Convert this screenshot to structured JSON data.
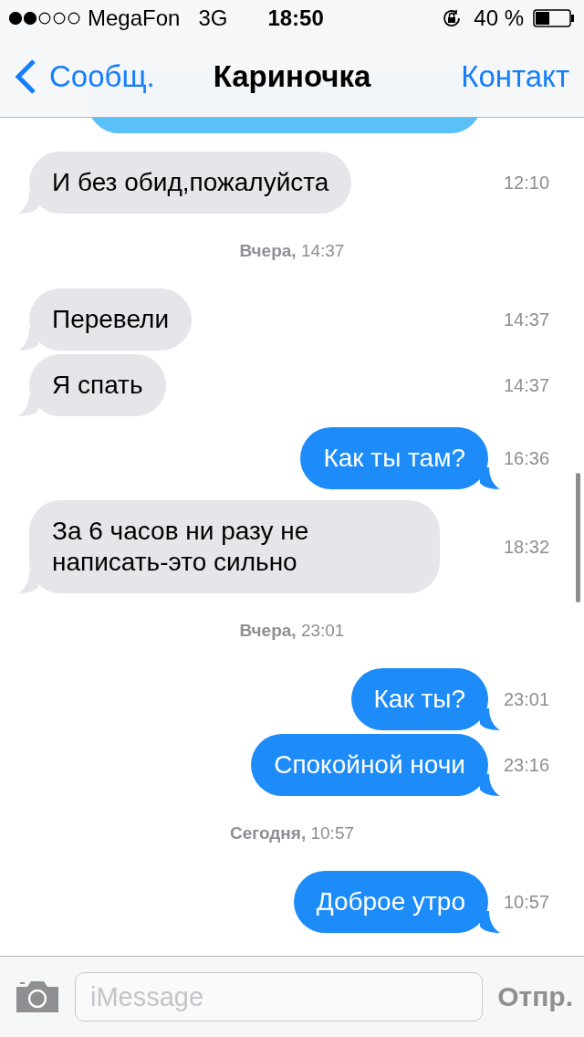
{
  "status_bar": {
    "carrier": "MegaFon",
    "network": "3G",
    "time": "18:50",
    "battery": "40 %"
  },
  "nav": {
    "back": "Сообщ.",
    "title": "Кариночка",
    "action": "Контакт"
  },
  "items": [
    {
      "kind": "incoming",
      "text": "И без обид,пожалуйста",
      "time": "12:10"
    },
    {
      "kind": "date",
      "text": "**Вчера,** 14:37"
    },
    {
      "kind": "incoming",
      "text": "Перевели",
      "time": "14:37"
    },
    {
      "kind": "incoming",
      "text": "Я спать",
      "time": "14:37"
    },
    {
      "kind": "outgoing",
      "text": "Как ты там?",
      "time": "16:36"
    },
    {
      "kind": "incoming",
      "text": "За 6 часов ни разу не написать-это сильно",
      "time": "18:32"
    },
    {
      "kind": "date",
      "text": "**Вчера,** 23:01"
    },
    {
      "kind": "outgoing",
      "text": "Как ты?",
      "time": "23:01"
    },
    {
      "kind": "outgoing",
      "text": "Спокойной ночи",
      "time": "23:16"
    },
    {
      "kind": "date",
      "text": "**Сегодня,** 10:57"
    },
    {
      "kind": "outgoing",
      "text": "Доброе утро",
      "time": "10:57"
    }
  ],
  "composer": {
    "placeholder": "iMessage",
    "send": {
      "label": "Отпр.",
      "disabled": true
    }
  }
}
